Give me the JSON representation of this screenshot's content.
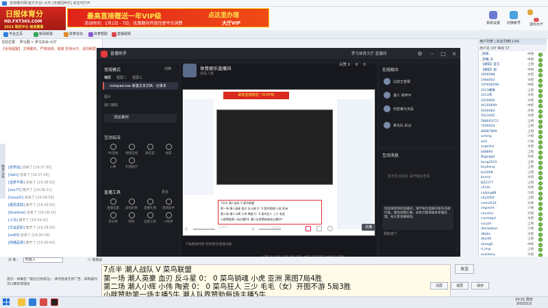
{
  "outer_window": {
    "title": "吉祥娱乐网(官方平台) 大厅 [天使回声乐] 双击可打开"
  },
  "banner": {
    "logo_line1": "日报体育分",
    "logo_line2": "HD.FXT365.COM",
    "logo_line3": "2013 明月平分 结束赛事",
    "ad_title": "最高直接赠送一年VIP级",
    "ad_sub": "活动时间：1月1日 - 7日，优惠期间开放任意平台消费",
    "ad_right1": "点这里办理",
    "ad_right2": "大厅VIP",
    "buttons": [
      {
        "label": "系统设置",
        "color": "#6a7bd1"
      },
      {
        "label": "切换帐号",
        "color": "#4aa3df"
      },
      {
        "label": "",
        "color": "#e1a43a"
      },
      {
        "label": "退出大厅",
        "color": "#d55"
      }
    ]
  },
  "toolbar": {
    "items": [
      {
        "label": "平台主页",
        "color": "#2f7fd8"
      },
      {
        "label": "新闻频道",
        "color": "#3aa757"
      },
      {
        "label": "体育论坛",
        "color": "#e08a2c"
      },
      {
        "label": "体育帮助",
        "color": "#8a5cd0"
      },
      {
        "label": "直播视频",
        "color": "#d84a4a"
      }
    ]
  },
  "left": {
    "address": "当前位置： 罗马圈 > 罗马协会-大厅",
    "notice": "【全场提醒】 文明聊天，严禁违规，谢谢 支持大厅，请勿刷屏",
    "side_label": "体育公告",
    "chat": [
      {
        "user": "[张学渝]",
        "text": " 进来了 [19:27:30]"
      },
      {
        "user": "[Gelv]",
        "text": " 进来了 [19:27:34]"
      },
      {
        "user": "[追梦不累]",
        "text": " 进来了 [19:28:02]"
      },
      {
        "user": "[xxx77]",
        "text": " 离开了 [19:28:31]"
      },
      {
        "user": "[luxuyl1]",
        "text": " 进来了 [19:28:59]"
      },
      {
        "user": "[顺风发财]",
        "text": " 离开了 [19:29:05]"
      },
      {
        "user": "[bluelove]",
        "text": " 进来了 [19:29:15]"
      },
      {
        "user": "[小乌]",
        "text": " 离开了 [19:29:41]"
      },
      {
        "user": "[华运足彩]",
        "text": " 离开了 [19:29:50]"
      },
      {
        "user": "[xx83]",
        "text": " 进来了 [19:30:18]"
      },
      {
        "user": "[阿潮品球]",
        "text": " 离开了 [19:30:42]"
      }
    ]
  },
  "right": {
    "tabs": "用户列表  |  好友列表(134)",
    "header": "用户名       VIP 等级  ST",
    "users": [
      {
        "name": "_啊来..",
        "rank": "中将"
      },
      {
        "name": "_荣耀_队",
        "rank": "中将"
      },
      {
        "name": "【通知】官方",
        "rank": "上将"
      },
      {
        "name": "【通知】副",
        "rank": "中将"
      },
      {
        "name": "1800098",
        "rank": "大校"
      },
      {
        "name": "1984003",
        "rank": "大校"
      },
      {
        "name": "197600599",
        "rank": "中校"
      },
      {
        "name": "2013赛事",
        "rank": "上将"
      },
      {
        "name": "2013年",
        "rank": "大校"
      },
      {
        "name": "2019000",
        "rank": "大校"
      },
      {
        "name": "44100699",
        "rank": "中校"
      },
      {
        "name": "5000083",
        "rank": "大校"
      },
      {
        "name": "5023405",
        "rank": "大校"
      },
      {
        "name": "588003711",
        "rank": "上将"
      },
      {
        "name": "7400024",
        "rank": "上将"
      },
      {
        "name": "89887899",
        "rank": "上将"
      },
      {
        "name": "acfeng",
        "rank": "少校"
      },
      {
        "name": "alsll",
        "rank": "少将"
      },
      {
        "name": "angelina",
        "rank": "大校"
      },
      {
        "name": "b88890",
        "rank": "上校"
      },
      {
        "name": "Bigpiggd",
        "rank": "大校"
      },
      {
        "name": "bong2019",
        "rank": "上将"
      },
      {
        "name": "boybeng",
        "rank": "上校"
      },
      {
        "name": "bu2008",
        "rank": "上将"
      },
      {
        "name": "bxxrly",
        "rank": "大校"
      },
      {
        "name": "BZ2277",
        "rank": "上将"
      },
      {
        "name": "c51dn",
        "rank": "大校"
      },
      {
        "name": "caibing88",
        "rank": "少校"
      },
      {
        "name": "cdy2002",
        "rank": "上校"
      },
      {
        "name": "celin2019",
        "rank": "大校"
      },
      {
        "name": "chgiesht",
        "rank": "少将"
      },
      {
        "name": "chunhui",
        "rank": "大校"
      },
      {
        "name": "crystalgsl",
        "rank": "大校"
      },
      {
        "name": "curyzh",
        "rank": "上将"
      },
      {
        "name": "daxiaobao",
        "rank": "少将"
      },
      {
        "name": "dbbbs",
        "rank": "大校"
      },
      {
        "name": "dkxl00",
        "rank": "上校"
      },
      {
        "name": "dxlmg8",
        "rank": "中校"
      },
      {
        "name": "d_lmg",
        "rank": "上将"
      },
      {
        "name": "ecollietry",
        "rank": "大校"
      },
      {
        "name": "ecfisu",
        "rank": "上校"
      },
      {
        "name": "ehm009",
        "rank": "少将"
      },
      {
        "name": "fdjg0s",
        "rank": "上校"
      },
      {
        "name": "faxxgxgx",
        "rank": "中校"
      }
    ]
  },
  "app": {
    "name": "直播助手",
    "scene_mode": "常规模式",
    "scene_switch": "切换",
    "scene_tabs": [
      "横屏",
      "竖屏二",
      "竖屏三"
    ],
    "active_scene": "notepad.exe 新建文本文档 - 记事本",
    "sources": [
      "图片",
      "窗口捕获"
    ],
    "add_source": "添加素材",
    "interact_title": "互动玩法",
    "interact_icons": [
      "PK连线",
      "视频连线",
      "聊天室",
      "福袋",
      "心愿",
      "礼物提示"
    ],
    "tools_title": "直播工具",
    "tools_more": "更多",
    "tools_icons": [
      "直播设置",
      "虚拟形象",
      "直播礼物",
      "游戏助手",
      "音乐库",
      "特效",
      "连麦工具",
      "小程序"
    ],
    "room_title": "体育娱乐直播间",
    "room_sub": "观看人数",
    "user": "罗马体育大厅 直播间",
    "stats": [
      "点赞 0",
      "6",
      "0"
    ],
    "preview_banner": "最高直接赠送一年VIP级",
    "preview_lines": [
      "7点半          潮人战队 V 菜鸟联盟",
      "第一场  潮人英豪 血刃 反斗星 0：0 菜鸟销魂 小虎 亚洲",
      "第二场  潮人小辉 小伟 陶瓷 0：0 菜鸟狂人 三少 毛毛",
      "小胖赞助第一场主播5牛  潮人队界赞助每场主播5牛"
    ],
    "vol_mic": "100%",
    "vol_speaker": "100%",
    "timer": "00:13:16",
    "end_label": "关播",
    "footer_hint": "下载直播伴侣 获取更多直播功能",
    "cpu": "CPU 5.41%  内存 46.23%  帧率 30  码率 0  掉帧 0.00%",
    "online_title": "在线观众",
    "online_users": [
      "白鸽王者赛",
      "潮人 吴梓平",
      "何爱琳与天民",
      "菜鸟队-彩云"
    ],
    "interact_panel_title": "互动消息",
    "empty_msg": "暂无互动消息 请开播后查看",
    "msg_text": "欢迎来到我的直播间，请不要在直播间发布违规内容，理性观看比赛，如有问题请联系客服处理，祝大家观赛愉快。",
    "ack": "我知道了"
  },
  "bottom": {
    "say_to_label": "对 象：",
    "say_to_value": "所有人",
    "private_label": "悄悄话",
    "input_lines": [
      "7点半                          潮人战队 V 菜鸟联盟",
      "第一场    潮人英豪 血刃 反斗星 0：  0 菜鸟销魂 小虎 亚洲        黑图7局4胜",
      "第二场    潮人小辉 小伟 陶瓷 0：  0 菜鸟狂人 三少 毛毛（女）开图不游 5局3胜",
      "小胖赞助第一场主播5牛    潮人队界赞助每场主播5牛"
    ],
    "send_label": "发送",
    "tip": "提示：如果您「是位已经成功」：请勿滥发无序广告，如有疑问可以联系管理员",
    "buttons": [
      "清屏",
      "滚屏",
      "保存"
    ]
  },
  "taskbar": {
    "time": "19:31 周日",
    "date": "2022/1/2"
  }
}
